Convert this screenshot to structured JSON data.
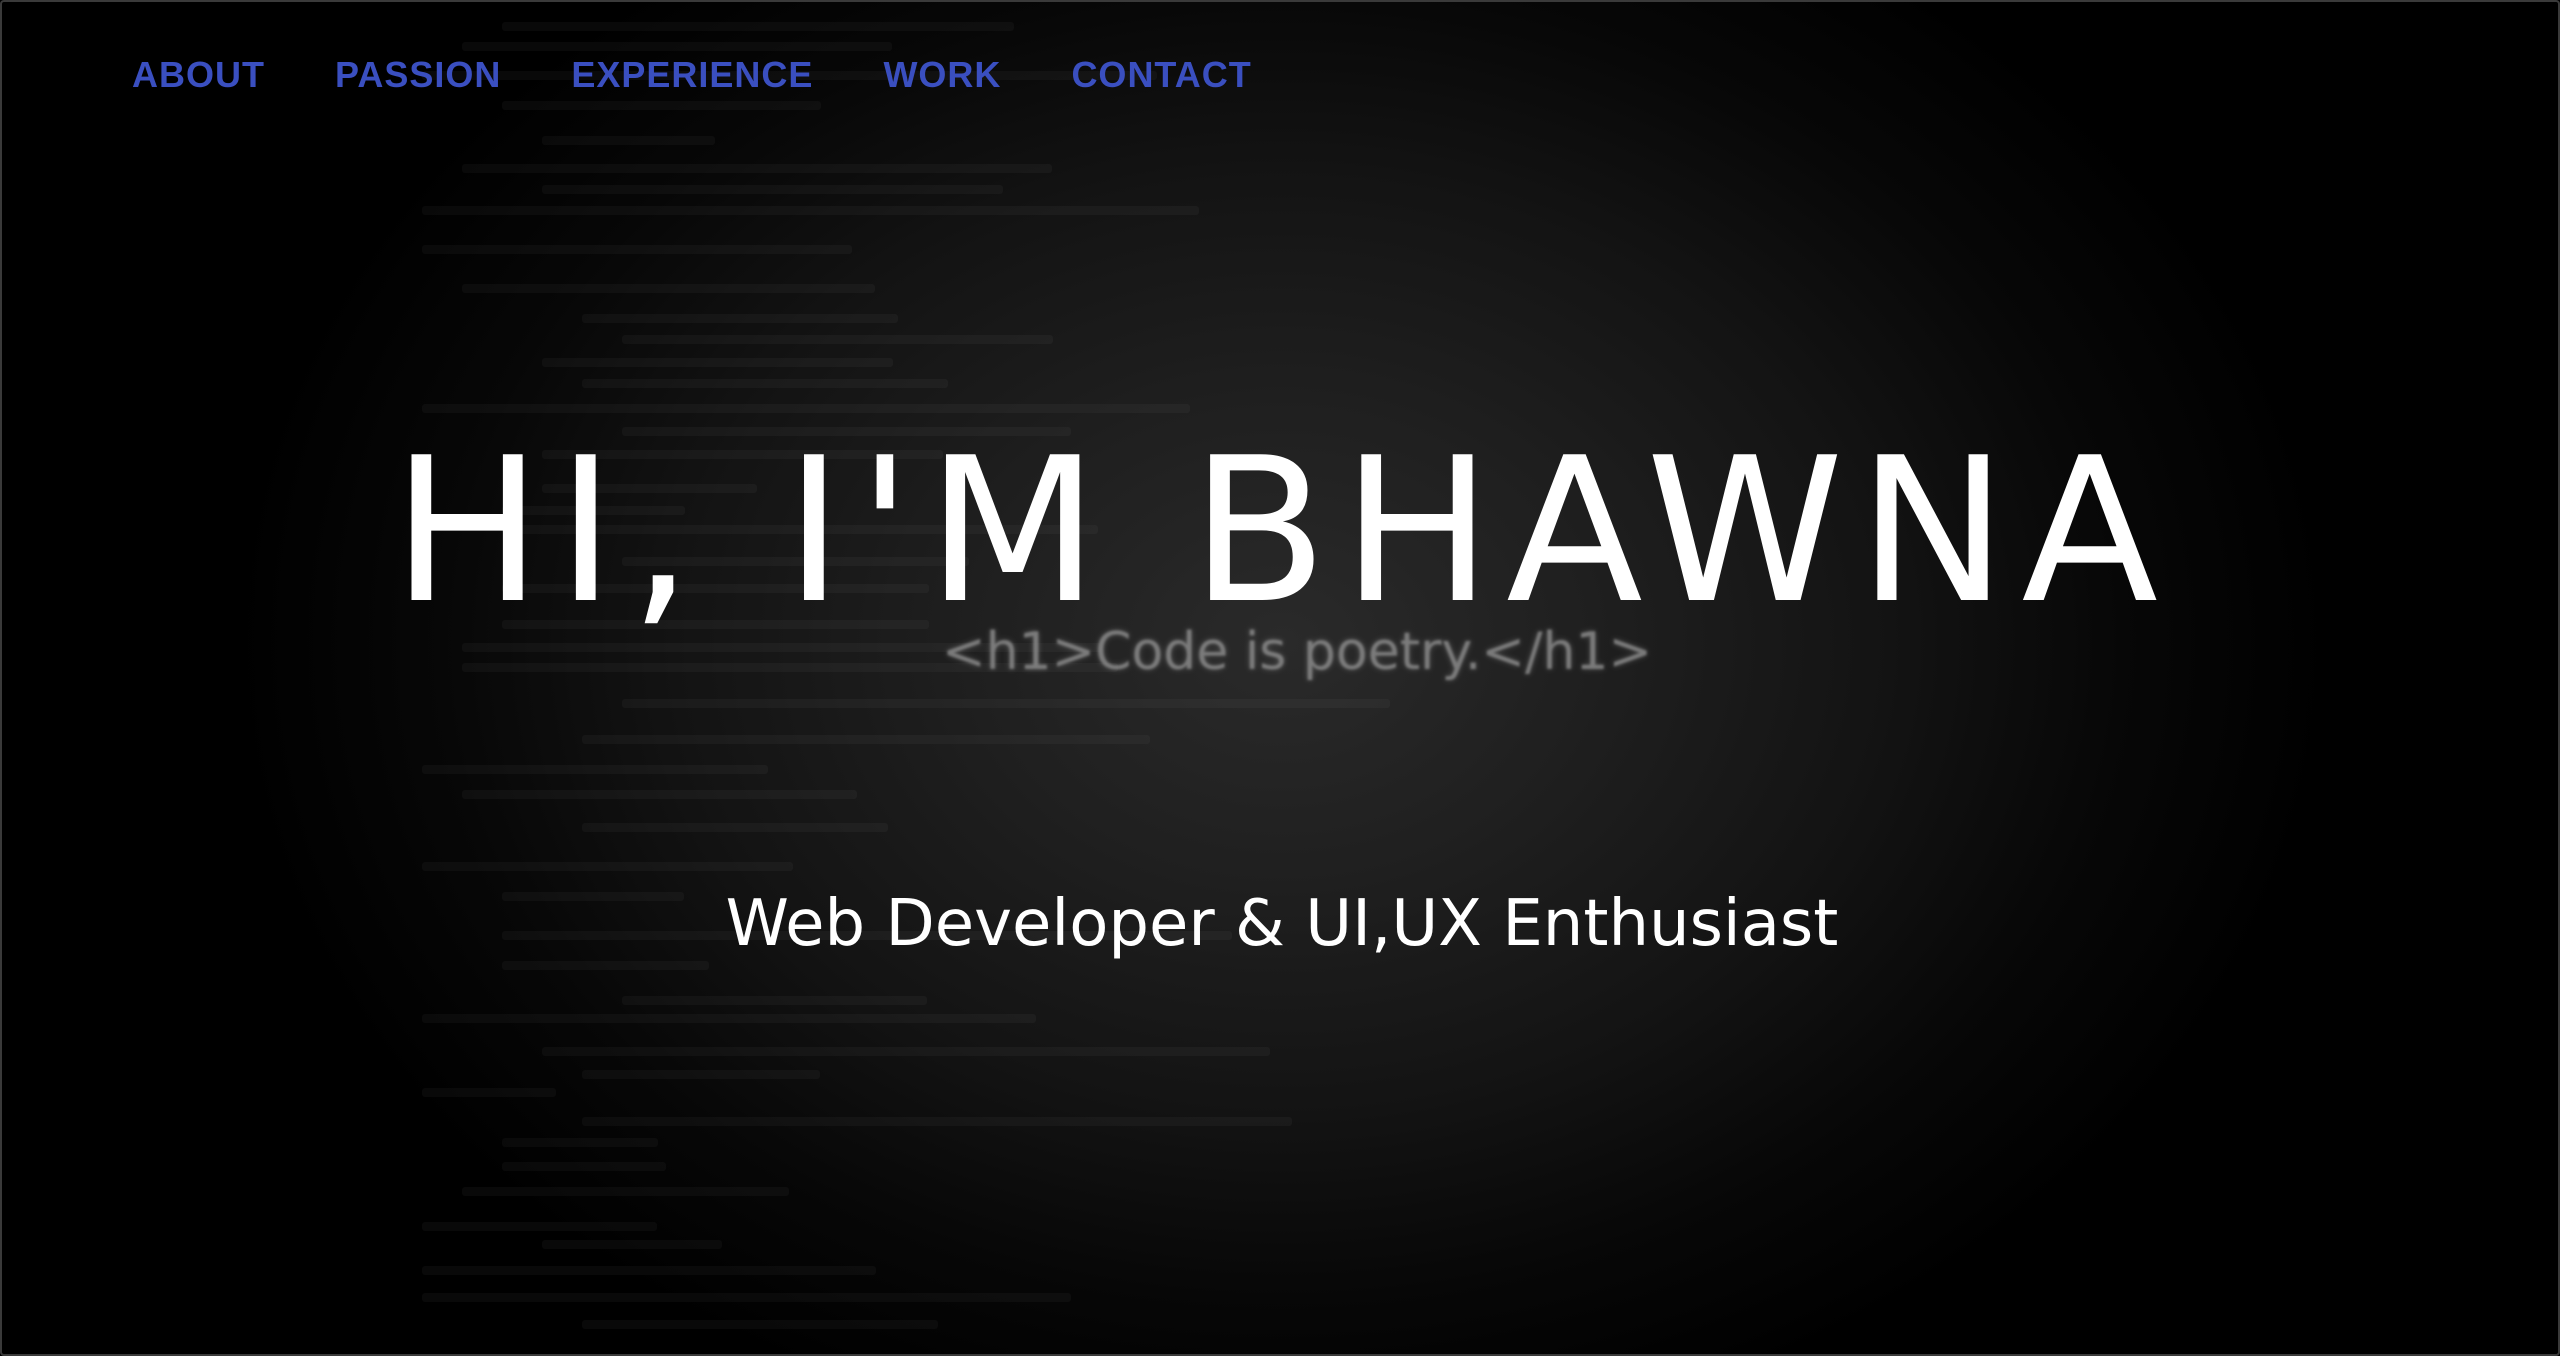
{
  "nav": {
    "items": [
      {
        "label": "ABOUT"
      },
      {
        "label": "PASSION"
      },
      {
        "label": "EXPERIENCE"
      },
      {
        "label": "WORK"
      },
      {
        "label": "CONTACT"
      }
    ],
    "color": "#3a4fc0"
  },
  "hero": {
    "title": "HI, I'M BHAWNA",
    "subtitle": "Web Developer & UI,UX Enthusiast",
    "background_text": "<h1>Code is poetry.</h1>"
  },
  "colors": {
    "background": "#000000",
    "text": "#ffffff"
  }
}
